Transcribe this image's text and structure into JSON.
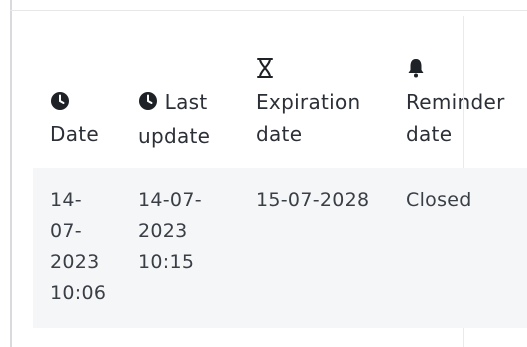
{
  "table": {
    "headers": {
      "date": {
        "line1": "Date"
      },
      "last_update": {
        "line1": "Last",
        "line2": "update"
      },
      "expiration_date": {
        "line1": "Expiration",
        "line2": "date"
      },
      "reminder_date": {
        "line1": "Reminder",
        "line2": "date"
      }
    },
    "icons": {
      "date": "clock-icon",
      "last_update": "clock-icon",
      "expiration_date": "hourglass-icon",
      "reminder_date": "bell-icon"
    },
    "rows": [
      {
        "date": [
          "14-",
          "07-",
          "2023",
          "10:06"
        ],
        "last_update": [
          "14-07-",
          "2023",
          "10:15"
        ],
        "expiration_date": "15-07-2028",
        "reminder_date": "Closed"
      }
    ]
  },
  "colors": {
    "text": "#2b2f36",
    "row_background": "#f5f6f8",
    "border": "#d8dadd"
  }
}
